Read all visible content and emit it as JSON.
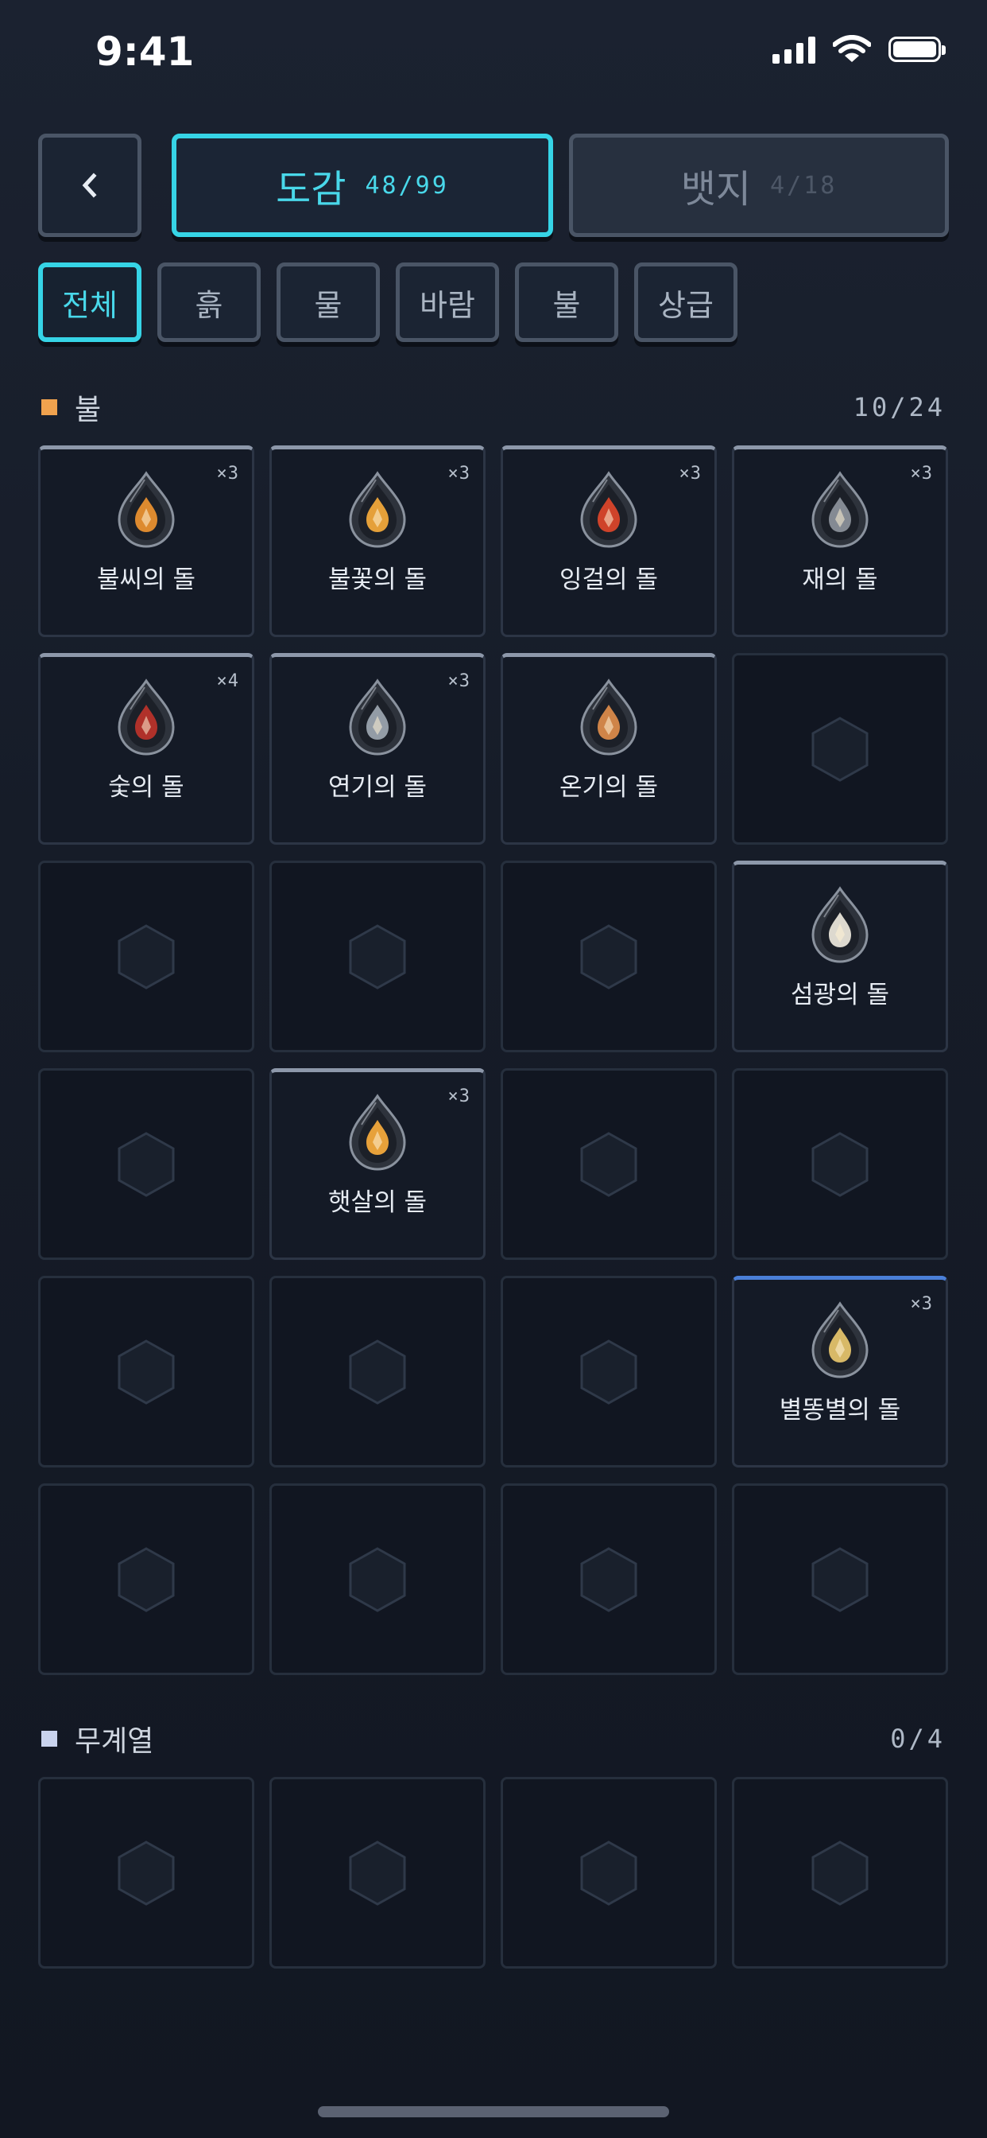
{
  "status": {
    "time": "9:41"
  },
  "header": {
    "back_icon": "chevron-left-icon",
    "tabs": [
      {
        "label": "도감",
        "count": "48/99",
        "active": true
      },
      {
        "label": "뱃지",
        "count": "4/18",
        "active": false
      }
    ]
  },
  "filters": [
    {
      "label": "전체",
      "active": true
    },
    {
      "label": "흙",
      "active": false
    },
    {
      "label": "물",
      "active": false
    },
    {
      "label": "바람",
      "active": false
    },
    {
      "label": "불",
      "active": false
    },
    {
      "label": "상급",
      "active": false
    }
  ],
  "sections": [
    {
      "name": "불",
      "count": "10/24",
      "marker_color": "#f0a24e",
      "cells": [
        {
          "name": "불씨의 돌",
          "qty": "×3",
          "gem_color": "#e8902f",
          "icon": "flame-rune-gem-icon"
        },
        {
          "name": "불꽃의 돌",
          "qty": "×3",
          "gem_color": "#f0a83a",
          "icon": "fire-gem-icon"
        },
        {
          "name": "잉걸의 돌",
          "qty": "×3",
          "gem_color": "#d9462a",
          "icon": "ember-gem-icon"
        },
        {
          "name": "재의 돌",
          "qty": "×3",
          "gem_color": "#8a9099",
          "icon": "ash-gem-icon"
        },
        {
          "name": "숯의 돌",
          "qty": "×4",
          "gem_color": "#b8332a",
          "icon": "charcoal-gem-icon"
        },
        {
          "name": "연기의 돌",
          "qty": "×3",
          "gem_color": "#9aa3ad",
          "icon": "smoke-gem-icon"
        },
        {
          "name": "온기의 돌",
          "qty": "",
          "gem_color": "#d98a4a",
          "icon": "warmth-gem-icon"
        },
        null,
        null,
        null,
        null,
        {
          "name": "섬광의 돌",
          "qty": "",
          "gem_color": "#e8e4d8",
          "icon": "flash-gem-icon"
        },
        null,
        {
          "name": "햇살의 돌",
          "qty": "×3",
          "gem_color": "#f2a93b",
          "icon": "sunlight-gem-icon"
        },
        null,
        null,
        null,
        null,
        null,
        {
          "name": "별똥별의 돌",
          "qty": "×3",
          "gem_color": "#e3c26a",
          "icon": "shooting-star-gem-icon",
          "highlight": "blue"
        },
        null,
        null,
        null,
        null
      ]
    },
    {
      "name": "무계열",
      "count": "0/4",
      "marker_color": "#c9d3ee",
      "cells": [
        null,
        null,
        null,
        null
      ]
    }
  ]
}
